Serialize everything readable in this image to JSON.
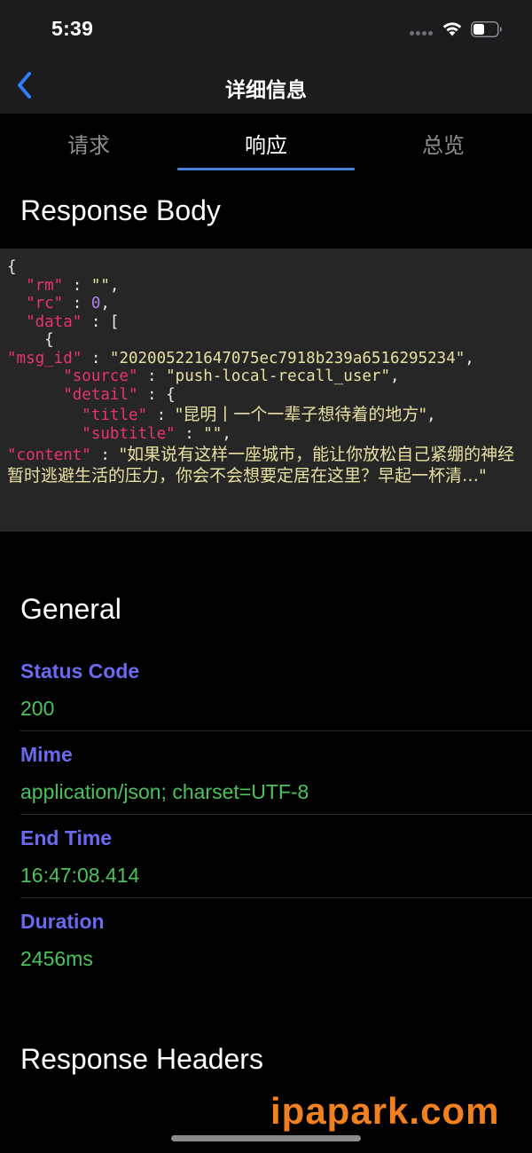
{
  "status_bar": {
    "time": "5:39"
  },
  "nav": {
    "title": "详细信息"
  },
  "tabs": [
    {
      "label": "请求",
      "active": false
    },
    {
      "label": "响应",
      "active": true
    },
    {
      "label": "总览",
      "active": false
    }
  ],
  "response_body": {
    "title": "Response Body",
    "json": {
      "open_brace": "{",
      "rm_key": "\"rm\"",
      "rm_value": "\"\"",
      "rc_key": "\"rc\"",
      "rc_value": "0",
      "data_key": "\"data\"",
      "data_open": "[",
      "item_open": "{",
      "msg_id_key": "\"msg_id\"",
      "msg_id_value": "\"202005221647075ec7918b239a6516295234\"",
      "source_key": "\"source\"",
      "source_value": "\"push-local-recall_user\"",
      "detail_key": "\"detail\"",
      "detail_open": "{",
      "title_key": "\"title\"",
      "title_value": "\"昆明丨一个一辈子想待着的地方\"",
      "subtitle_key": "\"subtitle\"",
      "subtitle_value": "\"\"",
      "content_key": "\"content\"",
      "content_value": "\"如果说有这样一座城市，能让你放松自己紧绷的神经暂时逃避生活的压力，你会不会想要定居在这里？早起一杯清…\""
    }
  },
  "general": {
    "title": "General",
    "fields": [
      {
        "label": "Status Code",
        "value": "200"
      },
      {
        "label": "Mime",
        "value": "application/json; charset=UTF-8"
      },
      {
        "label": "End Time",
        "value": "16:47:08.414"
      },
      {
        "label": "Duration",
        "value": "2456ms"
      }
    ]
  },
  "response_headers": {
    "title": "Response Headers"
  },
  "watermark": "ipapark.com",
  "colors": {
    "background": "#000000",
    "bar": "#1c1c1e",
    "accent": "#2f7cf6",
    "tab_indicator": "#4a7fd9",
    "field_label": "#6a6af0",
    "field_value": "#4cc25a",
    "json_key": "#e8336f",
    "json_string": "#e8e0a0",
    "json_number": "#b080f0"
  }
}
